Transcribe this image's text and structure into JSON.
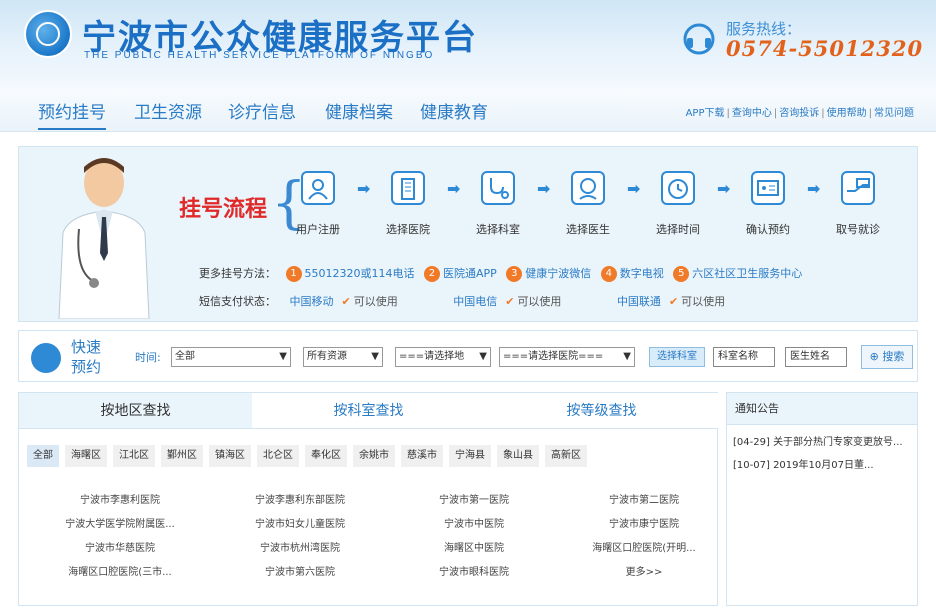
{
  "header": {
    "title": "宁波市公众健康服务平台",
    "subtitle": "THE PUBLIC HEALTH SERVICE PLATFORM OF NINGBO",
    "hotline_label": "服务热线：",
    "hotline_number": "0574-55012320"
  },
  "nav": {
    "items": [
      {
        "label": "预约挂号"
      },
      {
        "label": "卫生资源"
      },
      {
        "label": "诊疗信息"
      },
      {
        "label": "健康档案"
      },
      {
        "label": "健康教育"
      }
    ],
    "links": [
      "APP下载",
      "查询中心",
      "咨询投诉",
      "使用帮助",
      "常见问题"
    ]
  },
  "process": {
    "title": "挂号流程",
    "steps": [
      {
        "label": "用户注册",
        "icon": "user-icon"
      },
      {
        "label": "选择医院",
        "icon": "hospital-icon"
      },
      {
        "label": "选择科室",
        "icon": "stethoscope-icon"
      },
      {
        "label": "选择医生",
        "icon": "doctor-icon"
      },
      {
        "label": "选择时间",
        "icon": "alarm-clock-icon"
      },
      {
        "label": "确认预约",
        "icon": "id-card-icon"
      },
      {
        "label": "取号就诊",
        "icon": "hand-card-icon"
      }
    ],
    "methods_label": "更多挂号方法：",
    "methods": [
      {
        "num": "1",
        "text": "55012320或114电话"
      },
      {
        "num": "2",
        "text": "医院通APP"
      },
      {
        "num": "3",
        "text": "健康宁波微信"
      },
      {
        "num": "4",
        "text": "数字电视"
      },
      {
        "num": "5",
        "text": "六区社区卫生服务中心"
      }
    ],
    "pay_label": "短信支付状态：",
    "pay": [
      {
        "carrier": "中国移动",
        "status": "可以使用"
      },
      {
        "carrier": "中国电信",
        "status": "可以使用"
      },
      {
        "carrier": "中国联通",
        "status": "可以使用"
      }
    ]
  },
  "quick": {
    "title_line1": "快速",
    "title_line2": "预约",
    "time_label": "时间:",
    "time_value": "全部",
    "resource_value": "所有资源",
    "area_value": "===请选择地",
    "hospital_value": "===请选择医院===",
    "dept_button": "选择科室",
    "dept_input": "科室名称",
    "doctor_input": "医生姓名",
    "search_button": "搜索"
  },
  "search": {
    "tabs": [
      "按地区查找",
      "按科室查找",
      "按等级查找"
    ],
    "districts": [
      "全部",
      "海曙区",
      "江北区",
      "鄞州区",
      "镇海区",
      "北仑区",
      "奉化区",
      "余姚市",
      "慈溪市",
      "宁海县",
      "象山县",
      "高新区"
    ],
    "hospitals": [
      [
        "宁波市李惠利医院",
        "宁波李惠利东部医院",
        "宁波市第一医院",
        "宁波市第二医院"
      ],
      [
        "宁波大学医学院附属医...",
        "宁波市妇女儿童医院",
        "宁波市中医院",
        "宁波市康宁医院"
      ],
      [
        "宁波市华慈医院",
        "宁波市杭州湾医院",
        "海曙区中医院",
        "海曙区口腔医院(开明..."
      ],
      [
        "海曙区口腔医院(三市...",
        "宁波市第六医院",
        "宁波市眼科医院",
        "更多>>"
      ]
    ]
  },
  "notice": {
    "title": "通知公告",
    "items": [
      {
        "date": "[04-29]",
        "text": "关于部分热门专家变更放号..."
      },
      {
        "date": "[10-07]",
        "text": "2019年10月07日董..."
      }
    ]
  },
  "colors": {
    "brand_blue": "#1b6fc4",
    "link_blue": "#2a7bc5",
    "accent_orange": "#f07a27",
    "title_red": "#e02a2a"
  }
}
